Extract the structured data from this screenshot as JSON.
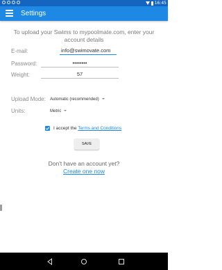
{
  "status_bar": {
    "time": "16:45"
  },
  "app_bar": {
    "title": "Settings"
  },
  "intro": "To upload your Swims to mypoolmate.com, enter your account details",
  "form": {
    "email_label": "E-mail:",
    "email_value": "info@swimovate.com",
    "password_label": "Password:",
    "password_value": "password",
    "weight_label": "Weight:",
    "weight_value": "57",
    "upload_mode_label": "Upload Mode:",
    "upload_mode_value": "Automatic (recommended)",
    "units_label": "Units:",
    "units_value": "Metric",
    "terms_prefix": "I accept the ",
    "terms_link": "Terms and Conditions",
    "terms_checked": true,
    "save_label": "SAVE"
  },
  "signup": {
    "prompt": "Don't have an account yet?",
    "link": "Create one now"
  },
  "colors": {
    "accent": "#1e88e5",
    "status_bar": "#1565c0"
  },
  "icons": {
    "menu": "menu-icon",
    "back": "back-icon",
    "home": "home-icon",
    "recent": "recent-apps-icon"
  }
}
